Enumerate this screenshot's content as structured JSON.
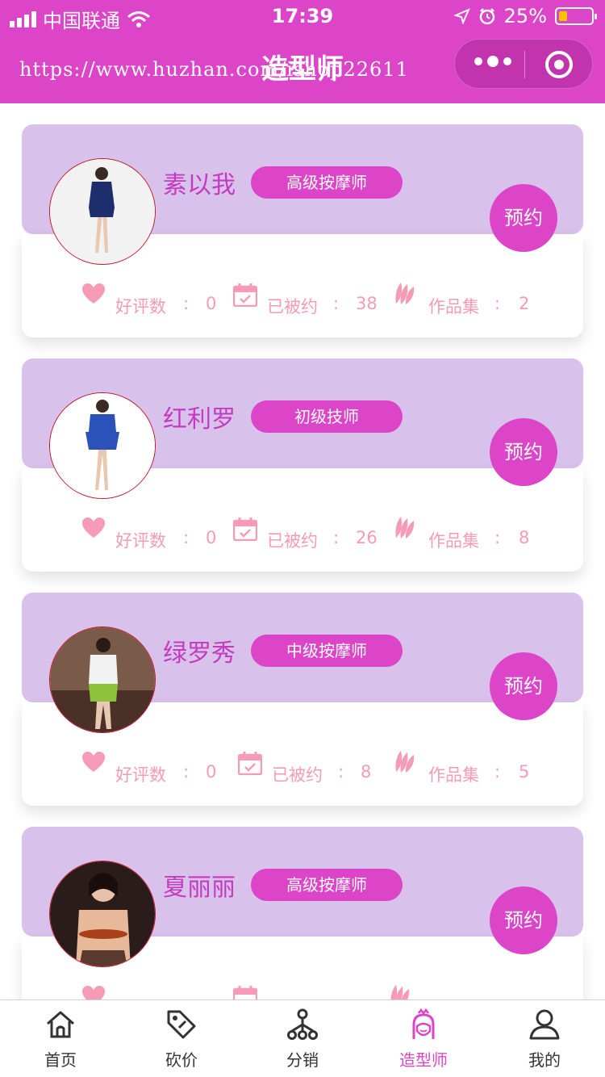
{
  "status_bar": {
    "carrier": "中国联通",
    "time": "17:39",
    "battery": "25%",
    "battery_level": 0.25
  },
  "nav": {
    "title": "造型师",
    "watermark": "https://www.huzhan.com/ishop22611"
  },
  "stat_labels": {
    "likes": "好评数",
    "booked": "已被约",
    "works": "作品集",
    "colon": ":"
  },
  "book_label": "预约",
  "stylists": [
    {
      "name": "素以我",
      "level": "高级按摩师",
      "likes": "0",
      "booked": "38",
      "works": "2"
    },
    {
      "name": "红利罗",
      "level": "初级技师",
      "likes": "0",
      "booked": "26",
      "works": "8"
    },
    {
      "name": "绿罗秀",
      "level": "中级按摩师",
      "likes": "0",
      "booked": "8",
      "works": "5"
    },
    {
      "name": "夏丽丽",
      "level": "高级按摩师"
    }
  ],
  "tabbar": [
    {
      "label": "首页",
      "icon": "home-icon"
    },
    {
      "label": "砍价",
      "icon": "price-tag-icon"
    },
    {
      "label": "分销",
      "icon": "distribution-tree-icon"
    },
    {
      "label": "造型师",
      "icon": "stylist-icon",
      "active": true
    },
    {
      "label": "我的",
      "icon": "user-icon"
    }
  ],
  "colors": {
    "primary": "#dd45c9",
    "card_top": "#d8c1ea",
    "stat_text": "#f59bb5",
    "name_text": "#c53bbf"
  }
}
